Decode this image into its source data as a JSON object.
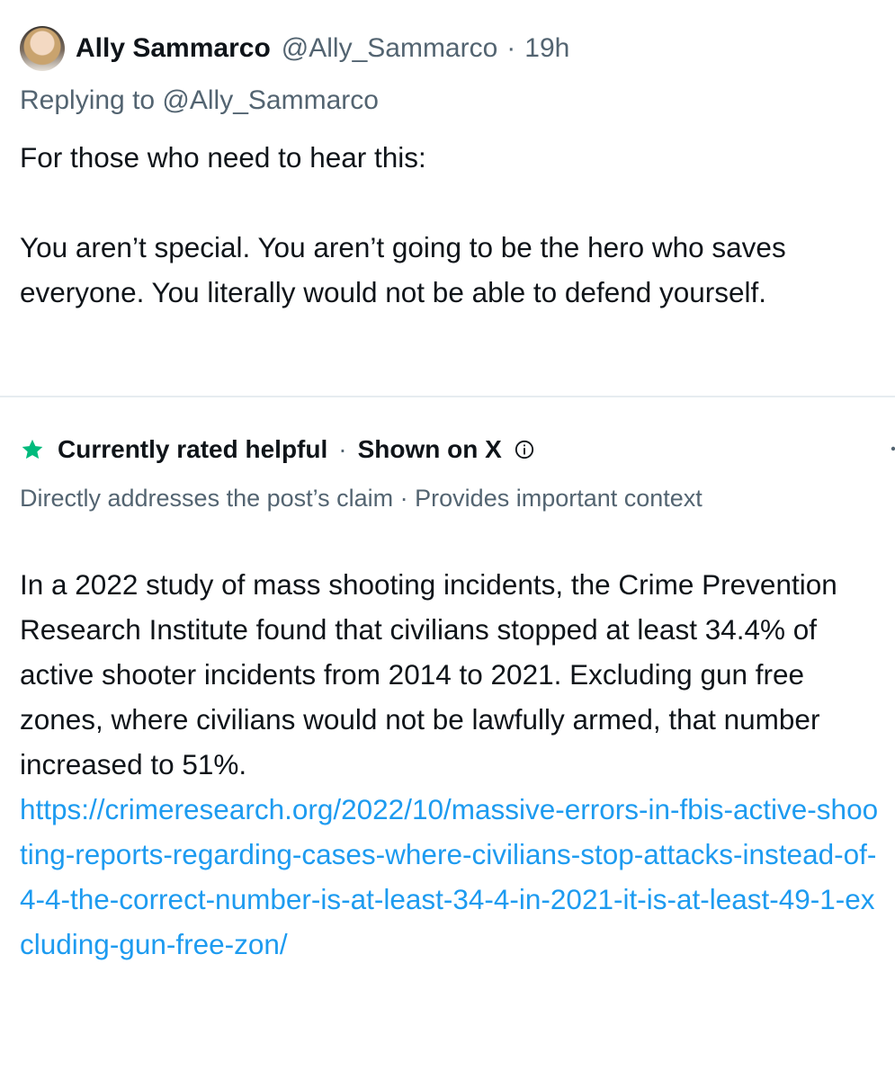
{
  "post": {
    "display_name": "Ally Sammarco",
    "handle": "@Ally_Sammarco",
    "separator": "·",
    "time": "19h",
    "replying_to": "Replying to @Ally_Sammarco",
    "paragraphs": [
      "For those who need to hear this:",
      "You aren’t special. You aren’t going to be the hero who saves everyone. You literally would not be able to defend yourself."
    ]
  },
  "community_note": {
    "status": "Currently rated helpful",
    "separator": "·",
    "shown_on": "Shown on X",
    "tags": "Directly addresses the post’s claim · Provides important context",
    "body": "In a 2022 study of mass shooting incidents, the Crime Prevention Research Institute found that civilians stopped at least 34.4% of active shooter incidents from 2014 to 2021. Excluding gun free zones, where civilians would not be lawfully armed, that number increased to 51%.",
    "link": "https://crimeresearch.org/2022/10/massive-errors-in-fbis-active-shooting-reports-regarding-cases-where-civilians-stop-attacks-instead-of-4-4-the-correct-number-is-at-least-34-4-in-2021-it-is-at-least-49-1-excluding-gun-free-zon/"
  },
  "icons": {
    "star": "star-icon",
    "info": "info-icon"
  },
  "colors": {
    "helpful_green": "#00ba7c",
    "link_blue": "#1d9bf0",
    "secondary_text": "#536471",
    "primary_text": "#0f1419"
  }
}
